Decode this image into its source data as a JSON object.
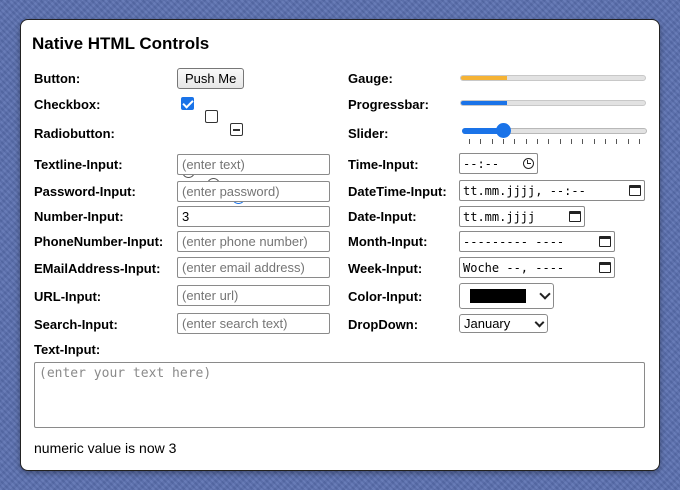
{
  "title": "Native HTML Controls",
  "labels": {
    "button": "Button:",
    "checkbox": "Checkbox:",
    "radiobutton": "Radiobutton:",
    "textline": "Textline-Input:",
    "password": "Password-Input:",
    "number": "Number-Input:",
    "phone": "PhoneNumber-Input:",
    "email": "EMailAddress-Input:",
    "url": "URL-Input:",
    "search": "Search-Input:",
    "text": "Text-Input:",
    "gauge": "Gauge:",
    "progressbar": "Progressbar:",
    "slider": "Slider:",
    "time": "Time-Input:",
    "datetime": "DateTime-Input:",
    "date": "Date-Input:",
    "month": "Month-Input:",
    "week": "Week-Input:",
    "color": "Color-Input:",
    "dropdown": "DropDown:"
  },
  "button": {
    "label": "Push Me"
  },
  "checkboxes": [
    "checked",
    "unchecked",
    "indeterminate"
  ],
  "radios": {
    "selected_index": 2
  },
  "inputs": {
    "textline_placeholder": "(enter text)",
    "password_placeholder": "(enter password)",
    "number_value": "3",
    "phone_placeholder": "(enter phone number)",
    "email_placeholder": "(enter email address)",
    "url_placeholder": "(enter url)",
    "search_placeholder": "(enter search text)",
    "text_placeholder": "(enter your text here)"
  },
  "gauge": {
    "value": 0.25,
    "color": "#f5b335"
  },
  "progressbar": {
    "value": 0.25,
    "color": "#1a73e8"
  },
  "slider": {
    "value": 0.2,
    "color": "#1a73e8",
    "ticks": 16
  },
  "time_value": "--:--",
  "datetime_value": "tt.mm.jjjj, --:--",
  "date_value": "tt.mm.jjjj",
  "month_value": "--------- ----",
  "week_value": "Woche --, ----",
  "color_value": "#000000",
  "dropdown_value": "January",
  "status_text": "numeric value is now 3"
}
